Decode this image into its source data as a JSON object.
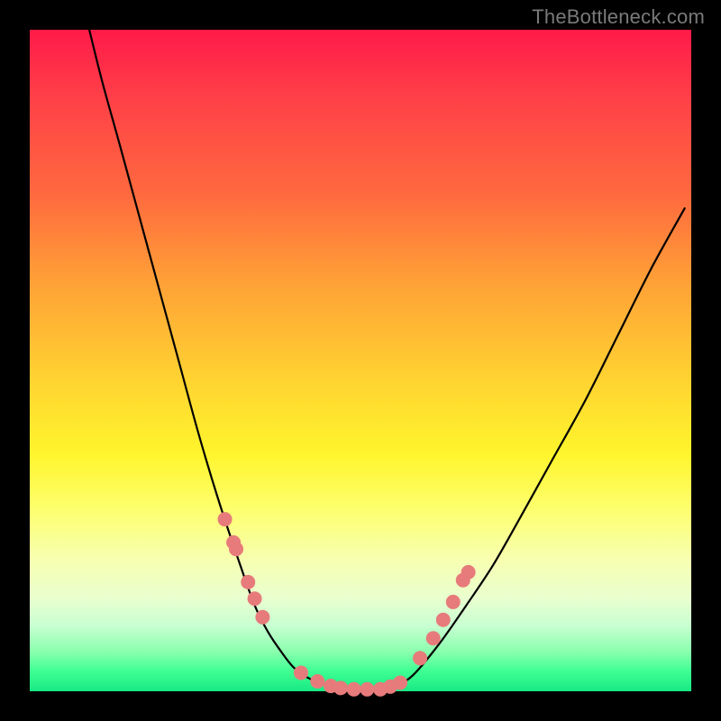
{
  "watermark": "TheBottleneck.com",
  "chart_data": {
    "type": "line",
    "title": "",
    "xlabel": "",
    "ylabel": "",
    "xlim": [
      0,
      100
    ],
    "ylim": [
      0,
      100
    ],
    "series": [
      {
        "name": "curve",
        "x_norm": [
          0.09,
          0.11,
          0.135,
          0.165,
          0.195,
          0.225,
          0.255,
          0.285,
          0.315,
          0.34,
          0.36,
          0.38,
          0.4,
          0.425,
          0.455,
          0.49,
          0.525,
          0.555,
          0.58,
          0.62,
          0.66,
          0.7,
          0.74,
          0.79,
          0.84,
          0.89,
          0.94,
          0.99
        ],
        "y_norm": [
          1.0,
          0.92,
          0.83,
          0.72,
          0.61,
          0.5,
          0.39,
          0.29,
          0.2,
          0.13,
          0.09,
          0.06,
          0.035,
          0.018,
          0.008,
          0.003,
          0.003,
          0.01,
          0.025,
          0.073,
          0.13,
          0.19,
          0.26,
          0.35,
          0.44,
          0.54,
          0.64,
          0.73
        ]
      }
    ],
    "markers": {
      "name": "dots",
      "color": "#e77b7b",
      "x_norm": [
        0.295,
        0.308,
        0.312,
        0.33,
        0.34,
        0.352,
        0.41,
        0.435,
        0.455,
        0.47,
        0.49,
        0.51,
        0.53,
        0.545,
        0.56,
        0.59,
        0.61,
        0.625,
        0.64,
        0.655,
        0.663
      ],
      "y_norm": [
        0.26,
        0.225,
        0.215,
        0.165,
        0.14,
        0.112,
        0.028,
        0.015,
        0.008,
        0.005,
        0.003,
        0.003,
        0.003,
        0.007,
        0.013,
        0.05,
        0.08,
        0.108,
        0.135,
        0.168,
        0.18
      ]
    }
  }
}
